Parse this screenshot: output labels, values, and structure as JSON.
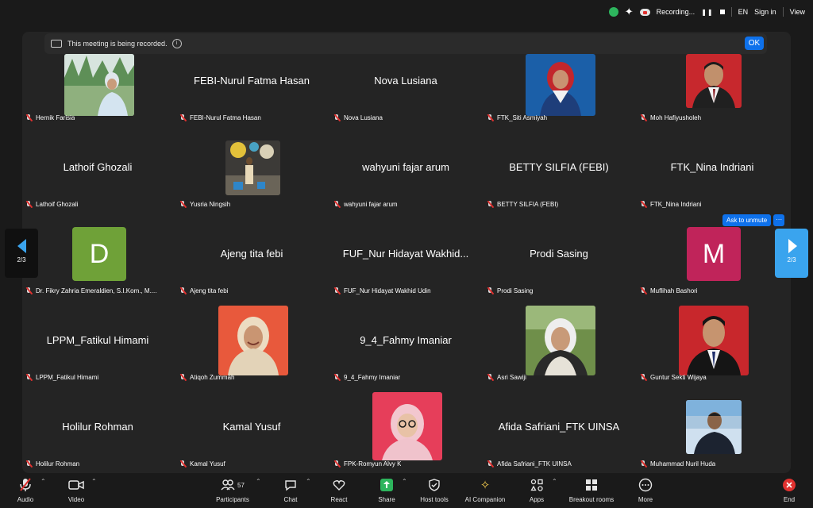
{
  "status_bar": {
    "recording_label": "Recording...",
    "language": "EN",
    "sign_in": "Sign in",
    "view": "View"
  },
  "banner": {
    "message": "This meeting is being recorded.",
    "ok": "OK",
    "info_glyph": "i"
  },
  "participants": [
    {
      "name": "Hernik Farisia",
      "display": "photo"
    },
    {
      "name": "FEBI-Nurul Fatma Hasan",
      "display": "name"
    },
    {
      "name": "Nova Lusiana",
      "display": "name"
    },
    {
      "name": "FTK_Siti Asmiyah",
      "display": "photo"
    },
    {
      "name": "Moh Hafiyusholeh",
      "display": "photo"
    },
    {
      "name": "Lathoif Ghozali",
      "display": "name"
    },
    {
      "name": "Yusria Ningsih",
      "display": "photo"
    },
    {
      "name": "wahyuni fajar arum",
      "display": "name"
    },
    {
      "name": "BETTY SILFIA (FEBI)",
      "display": "name"
    },
    {
      "name": "FTK_Nina Indriani",
      "display": "name"
    },
    {
      "name": "Dr. Fikry Zahria Emeraldien, S.I.Kom., M....",
      "display": "avatar",
      "initial": "D",
      "color": "#6fa138"
    },
    {
      "name": "Ajeng tita febi",
      "display": "name"
    },
    {
      "name": "FUF_Nur Hidayat Wakhid Udin",
      "big": "FUF_Nur Hidayat Wakhid...",
      "display": "name"
    },
    {
      "name": "Prodi Sasing",
      "display": "name"
    },
    {
      "name": "Muflihah Bashori",
      "display": "avatar",
      "initial": "M",
      "color": "#c0245a"
    },
    {
      "name": "LPPM_Fatikul Himami",
      "display": "name"
    },
    {
      "name": "Atiqoh Zummah",
      "display": "photo"
    },
    {
      "name": "9_4_Fahmy Imaniar",
      "display": "name"
    },
    {
      "name": "Asri Sawiji",
      "display": "photo"
    },
    {
      "name": "Guntur Sekti Wijaya",
      "display": "photo"
    },
    {
      "name": "Holilur Rohman",
      "display": "name"
    },
    {
      "name": "Kamal Yusuf",
      "display": "name"
    },
    {
      "name": "FPK-Romyun Alvy K",
      "display": "photo"
    },
    {
      "name": "Afida Safriani_FTK UINSA",
      "display": "name"
    },
    {
      "name": "Muhammad Nuril Huda",
      "display": "photo"
    }
  ],
  "pager": {
    "page_left": "2/3",
    "page_right": "2/3"
  },
  "unmute": {
    "label": "Ask to unmute",
    "more": "···"
  },
  "toolbar": {
    "audio": "Audio",
    "video": "Video",
    "participants": "Participants",
    "participant_count": "57",
    "chat": "Chat",
    "react": "React",
    "share": "Share",
    "host_tools": "Host tools",
    "ai_companion": "AI Companion",
    "apps": "Apps",
    "breakout_rooms": "Breakout rooms",
    "more": "More",
    "end": "End"
  },
  "colors": {
    "accent": "#0e71eb",
    "share": "#2db55d",
    "end": "#e0312f",
    "pager": "#3aa4ee"
  }
}
